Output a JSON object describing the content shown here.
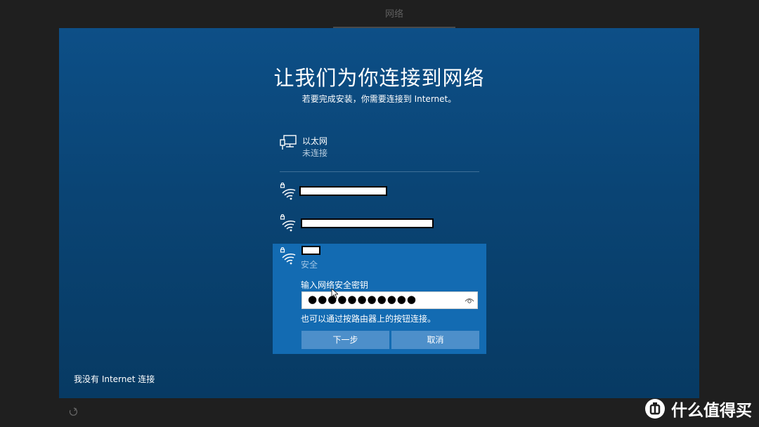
{
  "top_tab": {
    "label": "网络"
  },
  "main": {
    "title": "让我们为你连接到网络",
    "subtitle": "若要完成安装，你需要连接到 Internet。"
  },
  "ethernet": {
    "name": "以太网",
    "status": "未连接",
    "icon": "ethernet-icon"
  },
  "wifi_networks": [
    {
      "icon": "wifi-locked-icon",
      "name_redacted": true
    },
    {
      "icon": "wifi-locked-icon",
      "name_redacted": true
    },
    {
      "icon": "wifi-locked-icon",
      "name_redacted": true,
      "selected": true
    }
  ],
  "selected_network": {
    "security": "安全",
    "key_label": "输入网络安全密钥",
    "password_value": "●●●●●●●●●●●",
    "reveal_icon": "eye-icon",
    "wps_hint": "也可以通过按路由器上的按钮连接。",
    "next_label": "下一步",
    "cancel_label": "取消"
  },
  "footer": {
    "no_internet": "我没有 Internet 连接",
    "accessibility_icon": "ease-of-access-icon"
  },
  "watermark": {
    "text": "什么值得买",
    "logo_icon": "smzdm-logo-icon"
  },
  "colors": {
    "panel": "#0a4474",
    "selected": "#136bb2",
    "button": "#4d8fca"
  }
}
